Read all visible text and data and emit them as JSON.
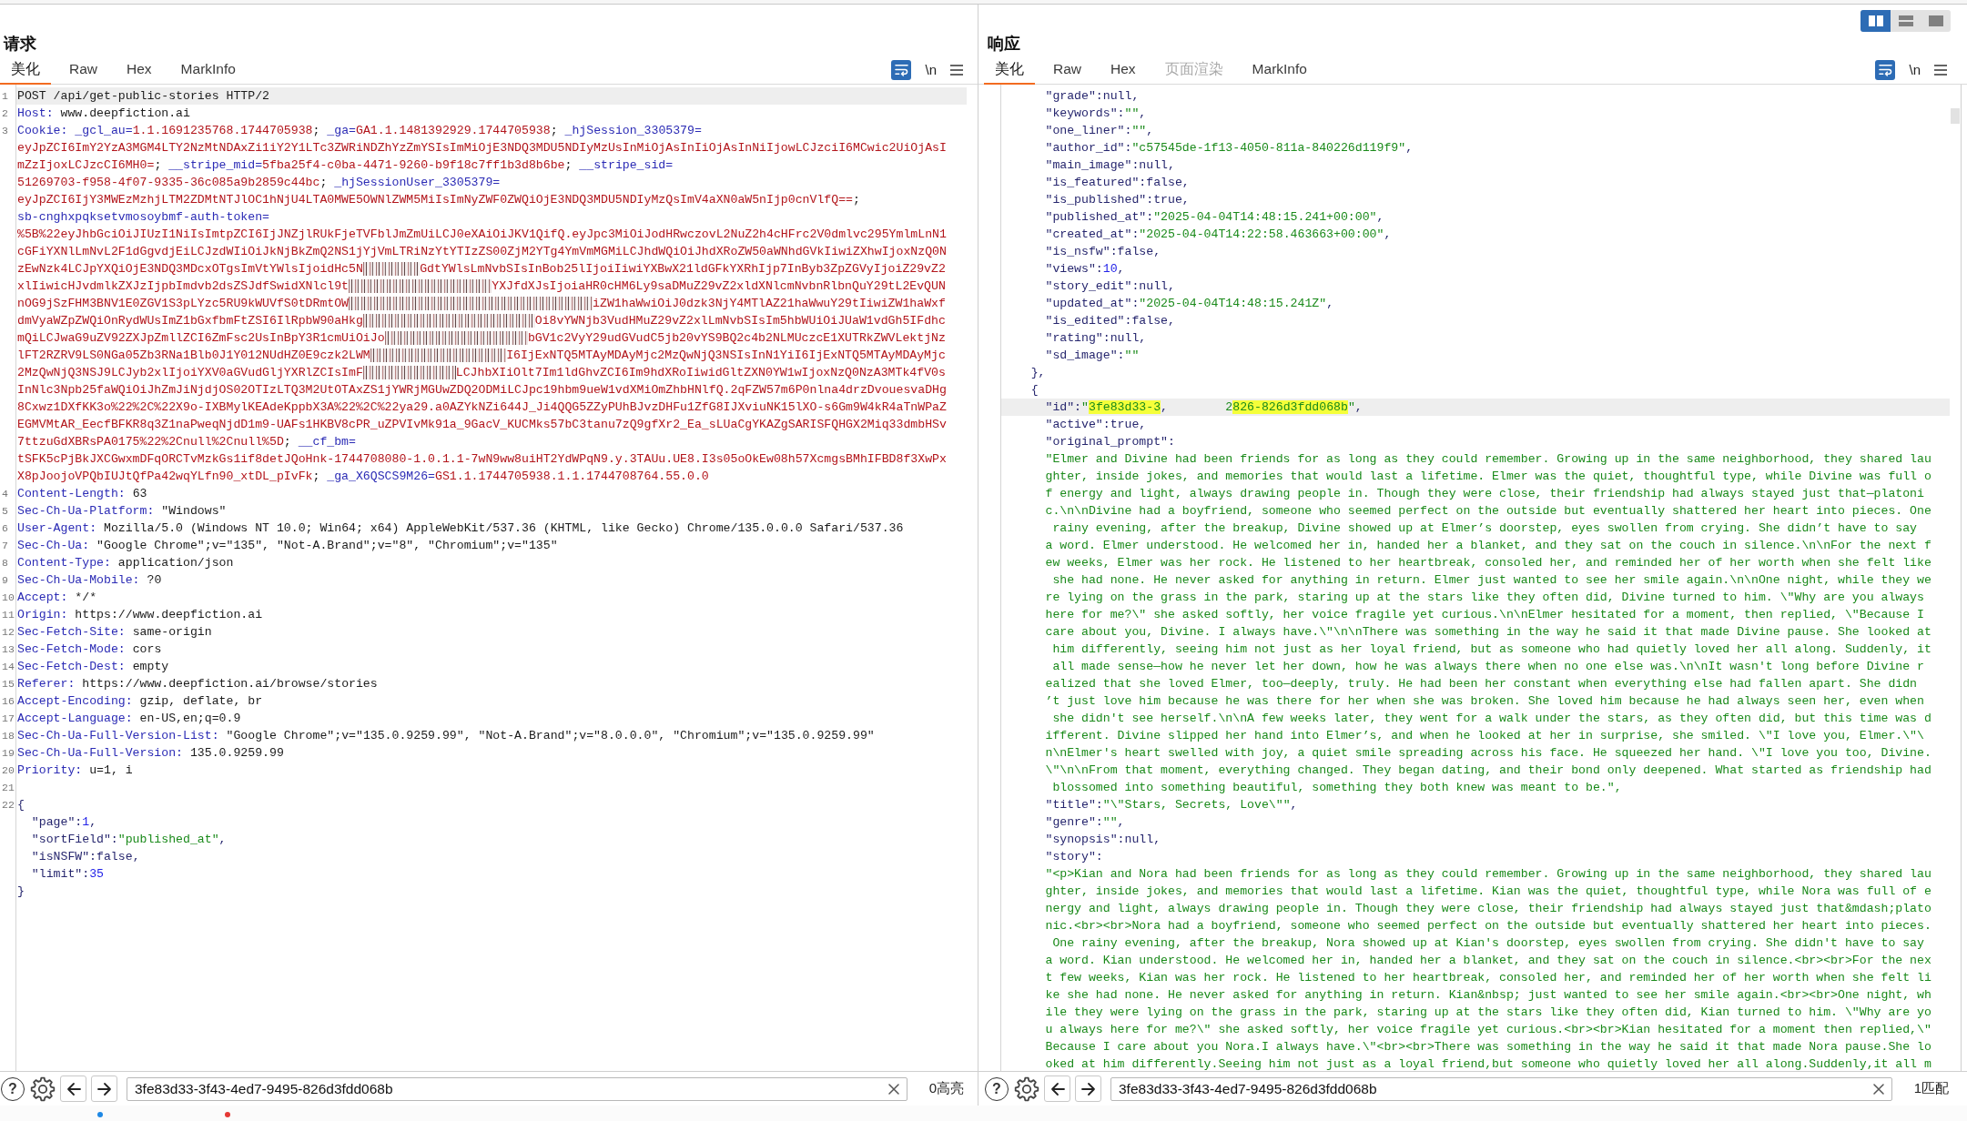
{
  "layout_switcher": [
    {
      "kind": "columns",
      "selected": true
    },
    {
      "kind": "rows",
      "selected": false
    },
    {
      "kind": "single",
      "selected": false
    }
  ],
  "request": {
    "title": "请求",
    "tabs": [
      {
        "label": "美化",
        "selected": true
      },
      {
        "label": "Raw",
        "selected": false
      },
      {
        "label": "Hex",
        "selected": false
      },
      {
        "label": "MarkInfo",
        "selected": false
      }
    ],
    "toolbar": {
      "wrap_on": true,
      "newline_label": "\\n"
    },
    "lines": [
      {
        "number": "1",
        "kind": "plain",
        "text": "POST /api/get-public-stories HTTP/2",
        "current": true
      },
      {
        "number": "2",
        "kind": "header",
        "name": "Host:",
        "value": "www.deepfiction.ai",
        "current": false
      },
      {
        "number": "3",
        "kind": "wrapped",
        "current": false,
        "rows": [
          {
            "segments": [
              {
                "text": "Cookie:",
                "kind": "name"
              },
              {
                "text": " _gcl_au=",
                "kind": "name"
              },
              {
                "text": "1.1.1691235768.1744705938",
                "kind": "cookie"
              },
              {
                "text": "; ",
                "kind": "plain"
              },
              {
                "text": "_ga=",
                "kind": "name"
              },
              {
                "text": "GA1.1.1481392929.1744705938",
                "kind": "cookie"
              },
              {
                "text": "; ",
                "kind": "plain"
              },
              {
                "text": "_hjSession_3305379=",
                "kind": "name"
              }
            ]
          },
          {
            "segments": [
              {
                "text": "eyJpZCI6ImY2YzA3MGM4LTY2NzMtNDAxZi1iY2Y1LTc3ZWRiNDZhYzZmYSIsImMiOjE3NDQ3MDU5NDIyMzUsInMiOjAsInIiOjAsInNiIjowLCJzciI6MCwic2UiOjAsI",
                "kind": "cookie"
              }
            ]
          },
          {
            "segments": [
              {
                "text": "mZzIjoxLCJzcCI6MH0=",
                "kind": "cookie"
              },
              {
                "text": "; ",
                "kind": "plain"
              },
              {
                "text": "__stripe_mid=",
                "kind": "name"
              },
              {
                "text": "5fba25f4-c0ba-4471-9260-b9f18c7ff1b3d8b6be",
                "kind": "cookie"
              },
              {
                "text": "; ",
                "kind": "plain"
              },
              {
                "text": "__stripe_sid=",
                "kind": "name"
              }
            ]
          },
          {
            "segments": [
              {
                "text": "51269703-f958-4f07-9335-36c085a9b2859c44bc",
                "kind": "cookie"
              },
              {
                "text": "; ",
                "kind": "plain"
              },
              {
                "text": "_hjSessionUser_3305379=",
                "kind": "name"
              }
            ]
          },
          {
            "segments": [
              {
                "text": "eyJpZCI6IjY3MWEzMzhjLTM2ZDMtNTJlOC1hNjU4LTA0MWE5OWNlZWM5MiIsImNyZWF0ZWQiOjE3NDQ3MDU5NDIyMzQsImV4aXN0aW5nIjp0cnVlfQ==",
                "kind": "cookie"
              },
              {
                "text": ";",
                "kind": "plain"
              }
            ]
          },
          {
            "segments": [
              {
                "text": "sb-cnghxpqksetvmosoybmf-auth-token=",
                "kind": "name"
              }
            ]
          },
          {
            "segments": [
              {
                "text": "%5B%22eyJhbGciOiJIUzI1NiIsImtpZCI6IjJNZjlRUkFjeTVFblJmZmUiLCJ0eXAiOiJKV1QifQ.eyJpc3MiOiJodHRwczovL2NuZ2h4cHFrc2V0dmlvc295YmlmLnN1",
                "kind": "cookie"
              }
            ]
          },
          {
            "segments": [
              {
                "text": "cGFiYXNlLmNvL2F1dGgvdjEiLCJzdWIiOiJkNjBkZmQ2NS1jYjVmLTRiNzYtYTIzZS00ZjM2YTg4YmVmMGMiLCJhdWQiOiJhdXRoZW50aWNhdGVkIiwiZXhwIjoxNzQ0N",
                "kind": "cookie"
              }
            ]
          },
          {
            "segments": [
              {
                "text": "zEwNzk4LCJpYXQiOjE3NDQ3MDcxOTgsImVtYWlsIjoidHc5N",
                "kind": "cookie"
              },
              {
                "kind": "blurred"
              },
              {
                "text": "GdtYWlsLmNvbSIsInBob25lIjoiIiwiYXBwX21ldGFkYXRhIjp7InByb3ZpZGVyIjoiZ29vZ2",
                "kind": "cookie"
              }
            ]
          },
          {
            "segments": [
              {
                "text": "xlIiwicHJvdmlkZXJzIjpbImdvb2dsZSJdfSwidXNlcl9t",
                "kind": "cookie"
              },
              {
                "kind": "blurred"
              },
              {
                "text": "YXJfdXJsIjoiaHR0cHM6Ly9saDMuZ29vZ2xldXNlcmNvbnRlbnQuY29tL2EvQUN",
                "kind": "cookie"
              }
            ]
          },
          {
            "segments": [
              {
                "text": "nOG9jSzFHM3BNV1E0ZGV1S3pLYzc5RU9kWUVfS0tDRmtOW",
                "kind": "cookie"
              },
              {
                "kind": "blurred"
              },
              {
                "text": "iZW1haWwiOiJ0dzk3NjY4MTlAZ21haWwuY29tIiwiZW1haWxf",
                "kind": "cookie"
              }
            ]
          },
          {
            "segments": [
              {
                "text": "dmVyaWZpZWQiOnRydWUsImZ1bGxfbmFtZSI6IlRpbW90aHkg",
                "kind": "cookie"
              },
              {
                "kind": "blurred"
              },
              {
                "text": "Oi8vYWNjb3VudHMuZ29vZ2xlLmNvbSIsIm5hbWUiOiJUaW1vdGh5IFdhc",
                "kind": "cookie"
              }
            ]
          },
          {
            "segments": [
              {
                "text": "mQiLCJwaG9uZV92ZXJpZmllZCI6ZmFsc2UsInBpY3R1cmUiOiJo",
                "kind": "cookie"
              },
              {
                "kind": "blurred"
              },
              {
                "text": "bGV1c2VyY29udGVudC5jb20vYS9BQ2c4b2NLMUczcE1XUTRkZWVLektjNz",
                "kind": "cookie"
              }
            ]
          },
          {
            "segments": [
              {
                "text": "lFT2RZRV9LS0NGa05Zb3RNa1Blb0J1Y012NUdHZ0E9czk2LWM",
                "kind": "cookie"
              },
              {
                "kind": "blurred"
              },
              {
                "text": "I6IjExNTQ5MTAyMDAyMjc2MzQwNjQ3NSIsInN1YiI6IjExNTQ5MTAyMDAyMjc",
                "kind": "cookie"
              }
            ]
          },
          {
            "segments": [
              {
                "text": "2MzQwNjQ3NSJ9LCJyb2xlIjoiYXV0aGVudGljYXRlZCIsImF",
                "kind": "cookie"
              },
              {
                "kind": "blurred"
              },
              {
                "text": "LCJhbXIiOlt7Im1ldGhvZCI6Im9hdXRoIiwidGltZXN0YW1wIjoxNzQ0NzA3MTk4fV0s",
                "kind": "cookie"
              }
            ]
          },
          {
            "segments": [
              {
                "text": "InNlc3Npb25faWQiOiJhZmJiNjdjOS02OTIzLTQ3M2UtOTAxZS1jYWRjMGUwZDQ2ODMiLCJpc19hbm9ueW1vdXMiOmZhbHNlfQ.2qFZW57m6P0nlna4drzDvouesvaDHg",
                "kind": "cookie"
              }
            ]
          },
          {
            "segments": [
              {
                "text": "8Cxwz1DXfKK3o%22%2C%22X9o-IXBMylKEAdeKppbX3A%22%2C%22ya29.a0AZYkNZi644J_Ji4QQG5ZZyPUhBJvzDHFu1ZfG8IJXviuNK15lXO-s6Gm9W4kR4aTnWPaZ",
                "kind": "cookie"
              }
            ]
          },
          {
            "segments": [
              {
                "text": "EGMVMtAR_EecfBFKR8q3Z1naPweqNjdD1m9-UAFs1HKBV8cPR_uZPVIvMk91a_9GacV_KUCMks57bC3tanu7zQ9gfXr2_Ea_sLUaCgYKAZgSARISFQHGX2Miq33dmbHSv",
                "kind": "cookie"
              }
            ]
          },
          {
            "segments": [
              {
                "text": "7ttzuGdXBRsPA0175%22%2Cnull%2Cnull%5D",
                "kind": "cookie"
              },
              {
                "text": "; ",
                "kind": "plain"
              },
              {
                "text": "__cf_bm=",
                "kind": "name"
              }
            ]
          },
          {
            "segments": [
              {
                "text": "tSFK5cPjBkJXCGwxmDFqORCTvMzkGs1if8detJQoHnk-1744708080-1.0.1.1-7wN9ww8uiHT2YdWPqN9.y.3TAUu.UE8.I3s05oOkEw08h57XcmgsBMhIFBD8f3XwPx",
                "kind": "cookie"
              }
            ]
          },
          {
            "segments": [
              {
                "text": "X8pJoojoVPQbIUJtQfPa42wqYLfn90_xtDL_pIvFk",
                "kind": "cookie"
              },
              {
                "text": "; ",
                "kind": "plain"
              },
              {
                "text": "_ga_X6QSCS9M26=",
                "kind": "name"
              },
              {
                "text": "GS1.1.1744705938.1.1.1744708764.55.0.0",
                "kind": "cookie"
              }
            ]
          }
        ]
      },
      {
        "number": "4",
        "kind": "header",
        "name": "Content-Length:",
        "value": "63",
        "current": false
      },
      {
        "number": "5",
        "kind": "header",
        "name": "Sec-Ch-Ua-Platform:",
        "value": "\"Windows\"",
        "current": false
      },
      {
        "number": "6",
        "kind": "header",
        "name": "User-Agent:",
        "value": "Mozilla/5.0 (Windows NT 10.0; Win64; x64) AppleWebKit/537.36 (KHTML, like Gecko) Chrome/135.0.0.0 Safari/537.36",
        "current": false
      },
      {
        "number": "7",
        "kind": "header",
        "name": "Sec-Ch-Ua:",
        "value": "\"Google Chrome\";v=\"135\", \"Not-A.Brand\";v=\"8\", \"Chromium\";v=\"135\"",
        "current": false
      },
      {
        "number": "8",
        "kind": "header",
        "name": "Content-Type:",
        "value": "application/json",
        "current": false
      },
      {
        "number": "9",
        "kind": "header",
        "name": "Sec-Ch-Ua-Mobile:",
        "value": "?0",
        "current": false
      },
      {
        "number": "10",
        "kind": "header",
        "name": "Accept:",
        "value": "*/*",
        "current": false
      },
      {
        "number": "11",
        "kind": "header",
        "name": "Origin:",
        "value": "https://www.deepfiction.ai",
        "current": false
      },
      {
        "number": "12",
        "kind": "header",
        "name": "Sec-Fetch-Site:",
        "value": "same-origin",
        "current": false
      },
      {
        "number": "13",
        "kind": "header",
        "name": "Sec-Fetch-Mode:",
        "value": "cors",
        "current": false
      },
      {
        "number": "14",
        "kind": "header",
        "name": "Sec-Fetch-Dest:",
        "value": "empty",
        "current": false
      },
      {
        "number": "15",
        "kind": "header",
        "name": "Referer:",
        "value": "https://www.deepfiction.ai/browse/stories",
        "current": false
      },
      {
        "number": "16",
        "kind": "header",
        "name": "Accept-Encoding:",
        "value": "gzip, deflate, br",
        "current": false
      },
      {
        "number": "17",
        "kind": "header",
        "name": "Accept-Language:",
        "value": "en-US,en;q=0.9",
        "current": false
      },
      {
        "number": "18",
        "kind": "header",
        "name": "Sec-Ch-Ua-Full-Version-List:",
        "value": "\"Google Chrome\";v=\"135.0.9259.99\", \"Not-A.Brand\";v=\"8.0.0.0\", \"Chromium\";v=\"135.0.9259.99\"",
        "current": false
      },
      {
        "number": "19",
        "kind": "header",
        "name": "Sec-Ch-Ua-Full-Version:",
        "value": "135.0.9259.99",
        "current": false
      },
      {
        "number": "20",
        "kind": "header",
        "name": "Priority:",
        "value": "u=1, i",
        "current": false
      },
      {
        "number": "21",
        "kind": "blank",
        "current": false
      },
      {
        "number": "22",
        "kind": "body",
        "current": false,
        "body": {
          "open": "{",
          "fields": [
            {
              "key": "\"page\":",
              "value": "1",
              "kind": "number",
              "end": ","
            },
            {
              "key": "\"sortField\":",
              "value": "\"published_at\"",
              "kind": "string",
              "end": ","
            },
            {
              "key": "\"isNSFW\":",
              "value": "false",
              "kind": "literal",
              "end": ","
            },
            {
              "key": "\"limit\":",
              "value": "35",
              "kind": "number"
            }
          ],
          "close": "}"
        }
      }
    ],
    "search": {
      "help_label": "?",
      "value": "3fe83d33-3f43-4ed7-9495-826d3fdd068b",
      "result": "0高亮"
    }
  },
  "response": {
    "title": "响应",
    "tabs": [
      {
        "label": "美化",
        "selected": true,
        "disabled": false
      },
      {
        "label": "Raw",
        "selected": false,
        "disabled": false
      },
      {
        "label": "Hex",
        "selected": false,
        "disabled": false
      },
      {
        "label": "页面渲染",
        "selected": false,
        "disabled": true
      },
      {
        "label": "MarkInfo",
        "selected": false,
        "disabled": false
      }
    ],
    "toolbar": {
      "wrap_on": true,
      "newline_label": "\\n"
    },
    "objects": [
      {
        "fields": [
          {
            "key": "\"grade\":",
            "value": "null",
            "kind": "literal",
            "end": ",",
            "current": false
          },
          {
            "key": "\"keywords\":",
            "value": "\"\"",
            "kind": "string",
            "end": ",",
            "current": false
          },
          {
            "key": "\"one_liner\":",
            "value": "\"\"",
            "kind": "string",
            "end": ",",
            "current": false
          },
          {
            "key": "\"author_id\":",
            "value": "\"c57545de-1f13-4050-811a-840226d119f9\"",
            "kind": "string",
            "end": ",",
            "current": false
          },
          {
            "key": "\"main_image\":",
            "value": "null",
            "kind": "literal",
            "end": ",",
            "current": false
          },
          {
            "key": "\"is_featured\":",
            "value": "false",
            "kind": "literal",
            "end": ",",
            "current": false
          },
          {
            "key": "\"is_published\":",
            "value": "true",
            "kind": "literal",
            "end": ",",
            "current": false
          },
          {
            "key": "\"published_at\":",
            "value": "\"2025-04-04T14:48:15.241+00:00\"",
            "kind": "string",
            "end": ",",
            "current": false
          },
          {
            "key": "\"created_at\":",
            "value": "\"2025-04-04T14:22:58.463663+00:00\"",
            "kind": "string",
            "end": ",",
            "current": false
          },
          {
            "key": "\"is_nsfw\":",
            "value": "false",
            "kind": "literal",
            "end": ",",
            "current": false
          },
          {
            "key": "\"views\":",
            "value": "10",
            "kind": "number",
            "end": ",",
            "current": false
          },
          {
            "key": "\"story_edit\":",
            "value": "null",
            "kind": "literal",
            "end": ",",
            "current": false
          },
          {
            "key": "\"updated_at\":",
            "value": "\"2025-04-04T14:48:15.241Z\"",
            "kind": "string",
            "end": ",",
            "current": false
          },
          {
            "key": "\"is_edited\":",
            "value": "false",
            "kind": "literal",
            "end": ",",
            "current": false
          },
          {
            "key": "\"rating\":",
            "value": "null",
            "kind": "literal",
            "end": ",",
            "current": false
          },
          {
            "key": "\"sd_image\":",
            "value": "\"\"",
            "kind": "string",
            "current": false
          }
        ],
        "close": "},"
      },
      {
        "open": "{",
        "fields": [
          {
            "key": "\"id\":",
            "kind": "segments",
            "segments": [
              {
                "text": "\"",
                "kind": "string"
              },
              {
                "text": "3fe83d33-3",
                "kind": "match"
              },
              {
                "text": ",",
                "kind": "punct"
              },
              {
                "text": "        2",
                "kind": "string"
              },
              {
                "text": "826-826d3fdd068b",
                "kind": "match"
              },
              {
                "text": "\"",
                "kind": "string"
              }
            ],
            "end": ",",
            "current": true
          },
          {
            "key": "\"active\":",
            "value": "true",
            "kind": "literal",
            "end": ",",
            "current": false
          },
          {
            "key": "\"original_prompt\":",
            "kind": "text_block",
            "current": false,
            "rows": [
              "\"Elmer and Divine had been friends for as long as they could remember. Growing up in the same neighborhood, they shared lau",
              "ghter, inside jokes, and memories that would last a lifetime. Elmer was the quiet, thoughtful type, while Divine was full o",
              "f energy and light, always drawing people in. Though they were close, their friendship had always stayed just that—platoni",
              "c.\\n\\nDivine had a boyfriend, someone who seemed perfect on the outside but eventually shattered her heart into pieces. One",
              " rainy evening, after the breakup, Divine showed up at Elmer’s doorstep, eyes swollen from crying. She didn’t have to say",
              "a word. Elmer understood. He welcomed her in, handed her a blanket, and they sat on the couch in silence.\\n\\nFor the next f",
              "ew weeks, Elmer was her rock. He listened to her heartbreak, consoled her, and reminded her of her worth when she felt like",
              " she had none. He never asked for anything in return. Elmer just wanted to see her smile again.\\n\\nOne night, while they we",
              "re lying on the grass in the park, staring up at the stars like they often did, Divine turned to him. \\\"Why are you always",
              "here for me?\\\" she asked softly, her voice fragile yet curious.\\n\\nElmer hesitated for a moment, then replied, \\\"Because I",
              "care about you, Divine. I always have.\\\"\\n\\nThere was something in the way he said it that made Divine pause. She looked at",
              " him differently, seeing him not just as her loyal friend, but as someone who had quietly loved her all along. Suddenly, it",
              " all made sense—how he never let her down, how he was always there when no one else was.\\n\\nIt wasn't long before Divine r",
              "ealized that she loved Elmer, too—deeply, truly. He had been her constant when everything else had fallen apart. She didn",
              "’t just love him because he was there for her when she was broken. She loved him because he had always seen her, even when",
              " she didn't see herself.\\n\\nA few weeks later, they went for a walk under the stars, as they often did, but this time was d",
              "ifferent. Divine slipped her hand into Elmer’s, and when he looked at her in surprise, she smiled. \\\"I love you, Elmer.\\\"\\",
              "n\\nElmer's heart swelled with joy, a quiet smile spreading across his face. He squeezed her hand. \\\"I love you too, Divine.",
              "\\\"\\n\\nFrom that moment, everything changed. They began dating, and their bond only deepened. What started as friendship had",
              " blossomed into something beautiful, something they both knew was meant to be.\","
            ]
          },
          {
            "key": "\"title\":",
            "value": "\"\\\"Stars, Secrets, Love\\\"\"",
            "kind": "string",
            "end": ",",
            "current": false
          },
          {
            "key": "\"genre\":",
            "value": "\"\"",
            "kind": "string",
            "end": ",",
            "current": false
          },
          {
            "key": "\"synopsis\":",
            "value": "null",
            "kind": "literal",
            "end": ",",
            "current": false
          },
          {
            "key": "\"story\":",
            "kind": "text_block",
            "current": false,
            "rows": [
              "\"<p>Kian and Nora had been friends for as long as they could remember. Growing up in the same neighborhood, they shared lau",
              "ghter, inside jokes, and memories that would last a lifetime. Kian was the quiet, thoughtful type, while Nora was full of e",
              "nergy and light, always drawing people in. Though they were close, their friendship had always stayed just that&mdash;plato",
              "nic.<br><br>Nora had a boyfriend, someone who seemed perfect on the outside but eventually shattered her heart into pieces.",
              " One rainy evening, after the breakup, Nora showed up at Kian's doorstep, eyes swollen from crying. She didn't have to say",
              "a word. Kian understood. He welcomed her in, handed her a blanket, and they sat on the couch in silence.<br><br>For the nex",
              "t few weeks, Kian was her rock. He listened to her heartbreak, consoled her, and reminded her of her worth when she felt li",
              "ke she had none. He never asked for anything in return. Kian&nbsp; just wanted to see her smile again.<br><br>One night, wh",
              "ile they were lying on the grass in the park, staring up at the stars like they often did, Kian turned to him. \\\"Why are yo",
              "u always here for me?\\\" she asked softly, her voice fragile yet curious.<br><br>Kian hesitated for a moment then replied,\\\"",
              "Because I care about you Nora.I always have.\\\"<br><br>There was something in the way he said it that made Nora pause.She lo",
              "oked at him differently.Seeing him not just as a loyal friend,but someone who quietly loved her all along.Suddenly,it all m"
            ]
          }
        ]
      }
    ],
    "search": {
      "help_label": "?",
      "value": "3fe83d33-3f43-4ed7-9495-826d3fdd068b",
      "result": "1匹配"
    }
  },
  "notification_dots": [
    {
      "color": "#1e88e5"
    },
    {
      "color": "#e53935"
    }
  ]
}
